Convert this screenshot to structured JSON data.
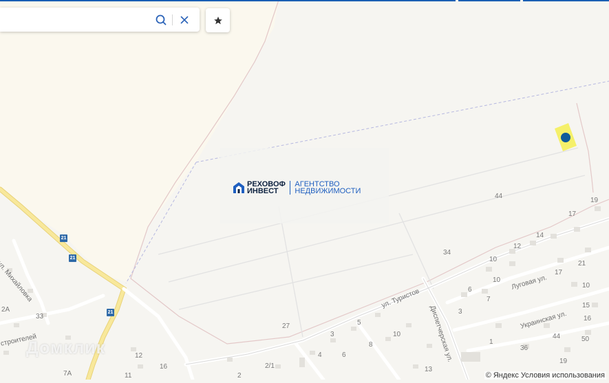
{
  "search": {
    "value": "",
    "placeholder": ""
  },
  "icons": {
    "search": "search-icon",
    "clear": "close-icon",
    "favorite": "star-icon"
  },
  "logo": {
    "name_line1": "РЕХОВОФ",
    "name_line2": "ИНВЕСТ",
    "agency_line1": "АГЕНТСТВО",
    "agency_line2": "НЕДВИЖИМОСТИ"
  },
  "streets": {
    "mikhailovka": "ул. Михайловка",
    "turistov": "ул. Туристов",
    "dispetcherskaya": "Диспетчерская ул.",
    "lugovaya": "Луговая ул.",
    "ukrainskaya": "Украинская ул.",
    "stroiteley": "строителей"
  },
  "house_numbers": [
    "44",
    "19",
    "17",
    "14",
    "12",
    "10",
    "21",
    "17",
    "10",
    "34",
    "6",
    "10",
    "7",
    "3",
    "15",
    "16",
    "44",
    "50",
    "1",
    "36",
    "19",
    "5",
    "3",
    "10",
    "8",
    "4",
    "6",
    "13",
    "2/1",
    "2",
    "11",
    "12",
    "16",
    "27",
    "33",
    "2A",
    "7A"
  ],
  "route_markers": [
    "21",
    "21",
    "21"
  ],
  "watermark": "Домклик",
  "attribution": "© Яндекс Условия использования",
  "colors": {
    "brand_blue": "#1f5fc0",
    "marker": "#0f5b9b",
    "highlight": "#f5f06a",
    "road_yellow": "#f7e08d"
  }
}
